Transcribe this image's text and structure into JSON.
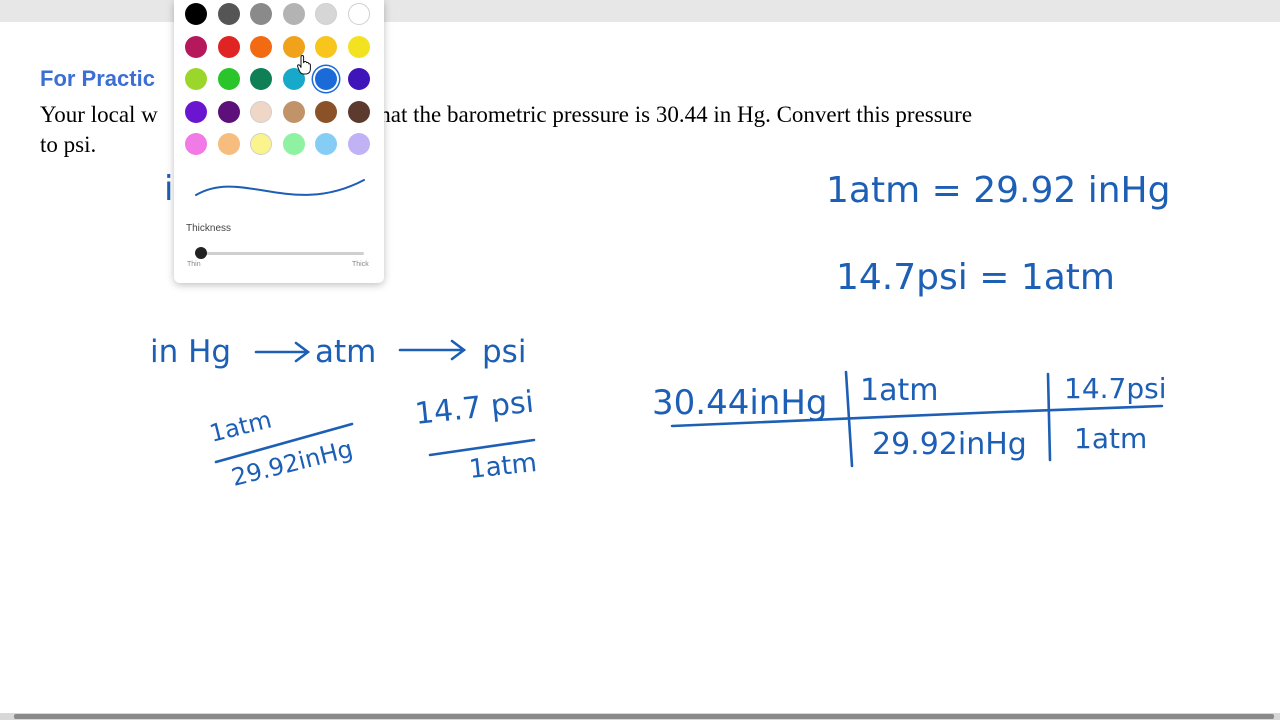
{
  "worksheet": {
    "heading": "For Practic",
    "problem_line1_start": "Your local w",
    "problem_line1_end": "ces that the barometric pressure is 30.44 in Hg. Convert this pressure",
    "problem_line2": "to psi."
  },
  "handwriting": {
    "partial_mark": "i",
    "eq1": "1atm = 29.92 inHg",
    "eq2": "14.7psi = 1atm",
    "path_in": "in Hg",
    "path_atm": "atm",
    "path_psi": "psi",
    "f1_num": "1atm",
    "f1_den": "29.92inHg",
    "f2_num": "14.7 psi",
    "f2_den": "1atm",
    "calc_start": "30.44inHg",
    "calc_n1": "1atm",
    "calc_d1": "29.92inHg",
    "calc_n2": "14.7psi",
    "calc_d2": "1atm"
  },
  "color_picker": {
    "swatches": [
      "#000000",
      "#555555",
      "#8a8a8a",
      "#b3b3b3",
      "#d6d6d6",
      "#ffffff",
      "#b5195b",
      "#e02424",
      "#f26b12",
      "#f0a21a",
      "#f7c51b",
      "#f2e21f",
      "#9ad72a",
      "#2ac52a",
      "#0f7f56",
      "#17a9c9",
      "#1a6ad8",
      "#3f14b8",
      "#6a16d0",
      "#5d0f7a",
      "#f0d6c5",
      "#c09468",
      "#8a5226",
      "#5c3a2e",
      "#f27ae6",
      "#f6bd7e",
      "#fbf48c",
      "#8ef2a2",
      "#86cdf6",
      "#c1b2f6"
    ],
    "selected_color": "#1a6ad8",
    "ink_color": "#1d5fb5",
    "thickness_label": "Thickness",
    "thin_label": "Thin",
    "thick_label": "Thick",
    "thickness_value": 0
  }
}
